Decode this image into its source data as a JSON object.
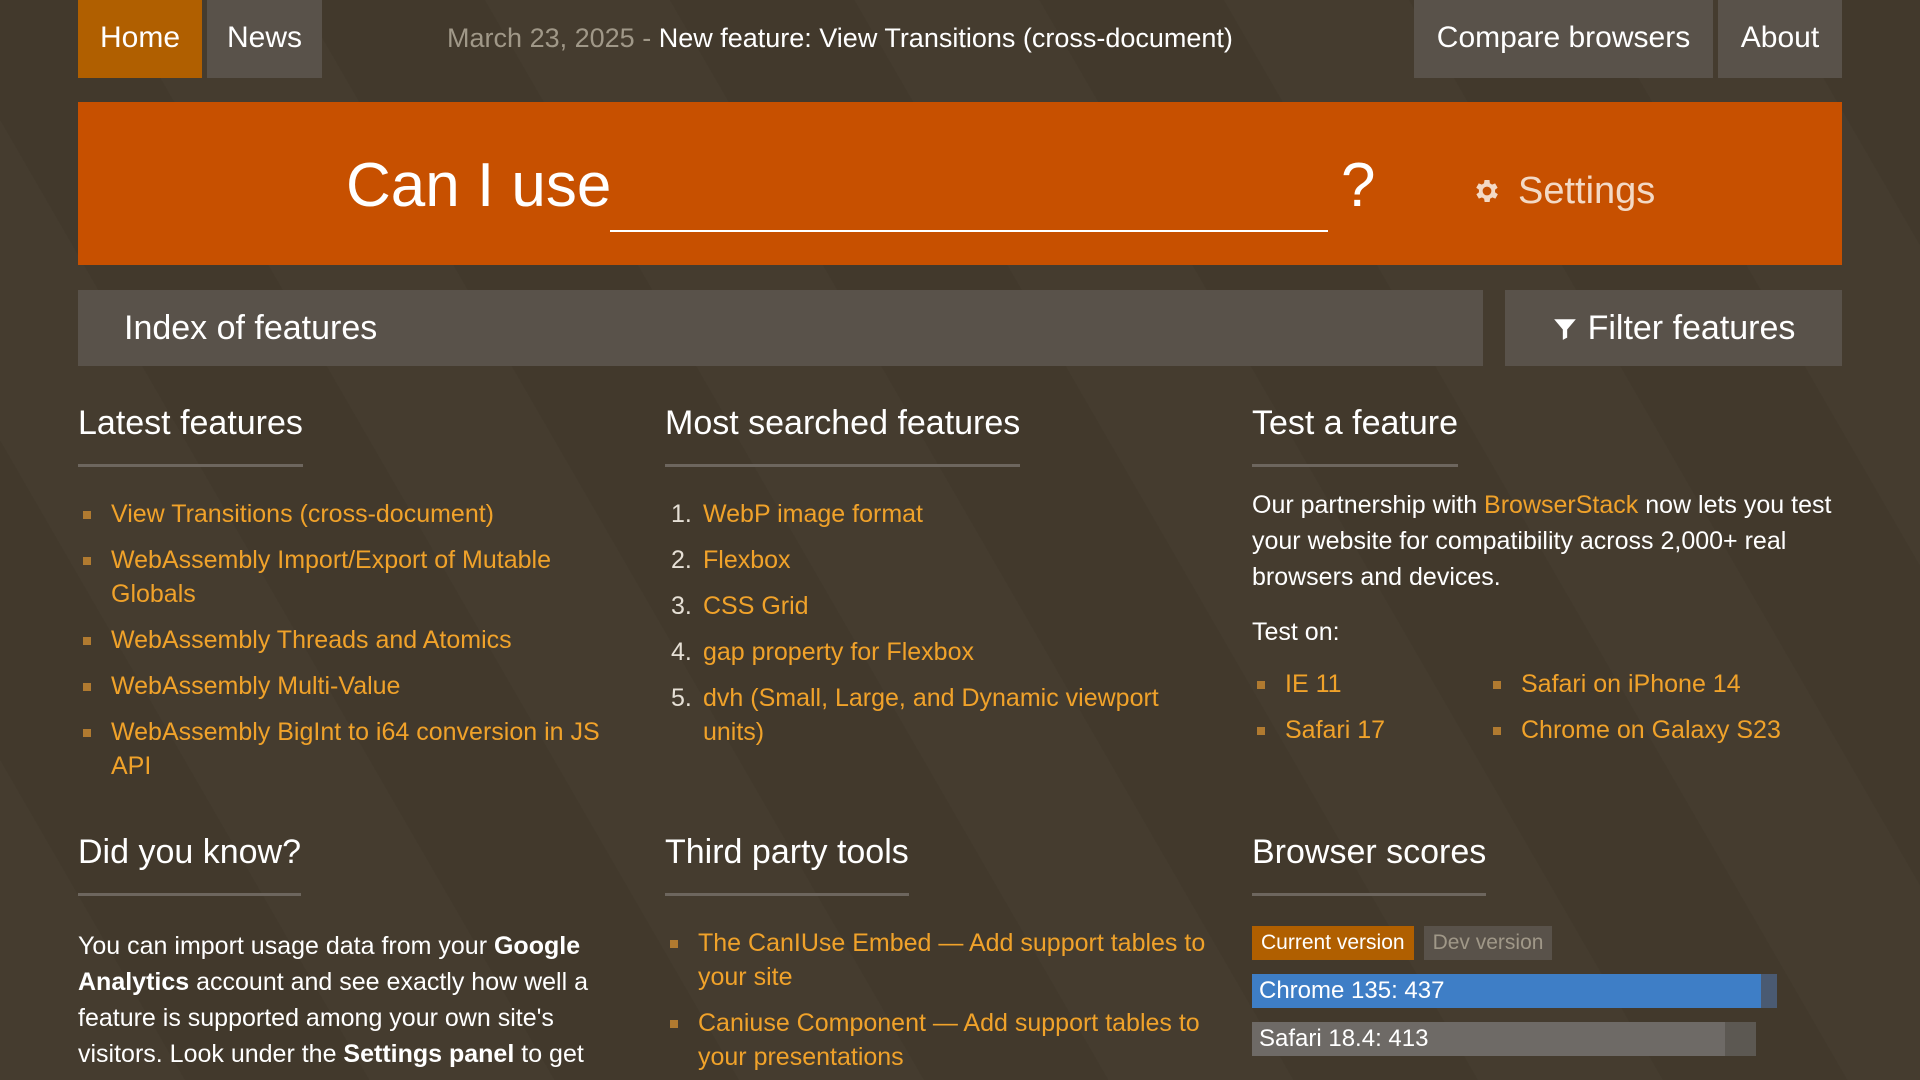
{
  "nav": {
    "home": "Home",
    "news": "News",
    "compare": "Compare browsers",
    "about": "About"
  },
  "announcement": {
    "date": "March 23, 2025",
    "separator": "-",
    "text": "New feature: View Transitions (cross-document)"
  },
  "search": {
    "prefix": "Can I use",
    "value": "",
    "suffix": "?",
    "settings_label": "Settings"
  },
  "index_bar": {
    "label": "Index of features",
    "filter_label": "Filter features"
  },
  "latest": {
    "title": "Latest features",
    "items": [
      "View Transitions (cross-document)",
      "WebAssembly Import/Export of Mutable Globals",
      "WebAssembly Threads and Atomics",
      "WebAssembly Multi-Value",
      "WebAssembly BigInt to i64 conversion in JS API"
    ]
  },
  "most_searched": {
    "title": "Most searched features",
    "items": [
      {
        "n": "1.",
        "label": "WebP image format"
      },
      {
        "n": "2.",
        "label": "Flexbox"
      },
      {
        "n": "3.",
        "label": "CSS Grid"
      },
      {
        "n": "4.",
        "label": "gap property for Flexbox"
      },
      {
        "n": "5.",
        "label": "dvh (Small, Large, and Dynamic viewport units)"
      }
    ]
  },
  "test": {
    "title": "Test a feature",
    "text_before": "Our partnership with ",
    "link": "BrowserStack",
    "text_after": " now lets you test your website for compatibility across 2,000+ real browsers and devices.",
    "test_on": "Test on:",
    "browsers_col1": [
      "IE 11",
      "Safari 17"
    ],
    "browsers_col2": [
      "Safari on iPhone 14",
      "Chrome on Galaxy S23"
    ]
  },
  "did_you_know": {
    "title": "Did you know?",
    "t1": "You can import usage data from your ",
    "b1": "Google Analytics",
    "t2": " account and see exactly how well a feature is supported among your own site's visitors. Look under the ",
    "b2": "Settings panel",
    "t3": " to get started!"
  },
  "third_party": {
    "title": "Third party tools",
    "items": [
      "The CanIUse Embed — Add support tables to your site",
      "Caniuse Component — Add support tables to your presentations"
    ]
  },
  "scores": {
    "title": "Browser scores",
    "tab_current": "Current version",
    "tab_dev": "Dev version",
    "bars": [
      {
        "label": "Chrome 135: 437",
        "score": 437,
        "max": 450,
        "color": "#3e7ec6",
        "track": "#4a5a72"
      },
      {
        "label": "Safari 18.4: 413",
        "score": 413,
        "max": 450,
        "color": "#6e6a66",
        "track": "#5c5852"
      }
    ]
  },
  "colors": {
    "accent": "#c75000",
    "nav_active": "#b05f00",
    "link": "#f0a22a",
    "background": "#433a2d",
    "panel": "#59524a"
  }
}
